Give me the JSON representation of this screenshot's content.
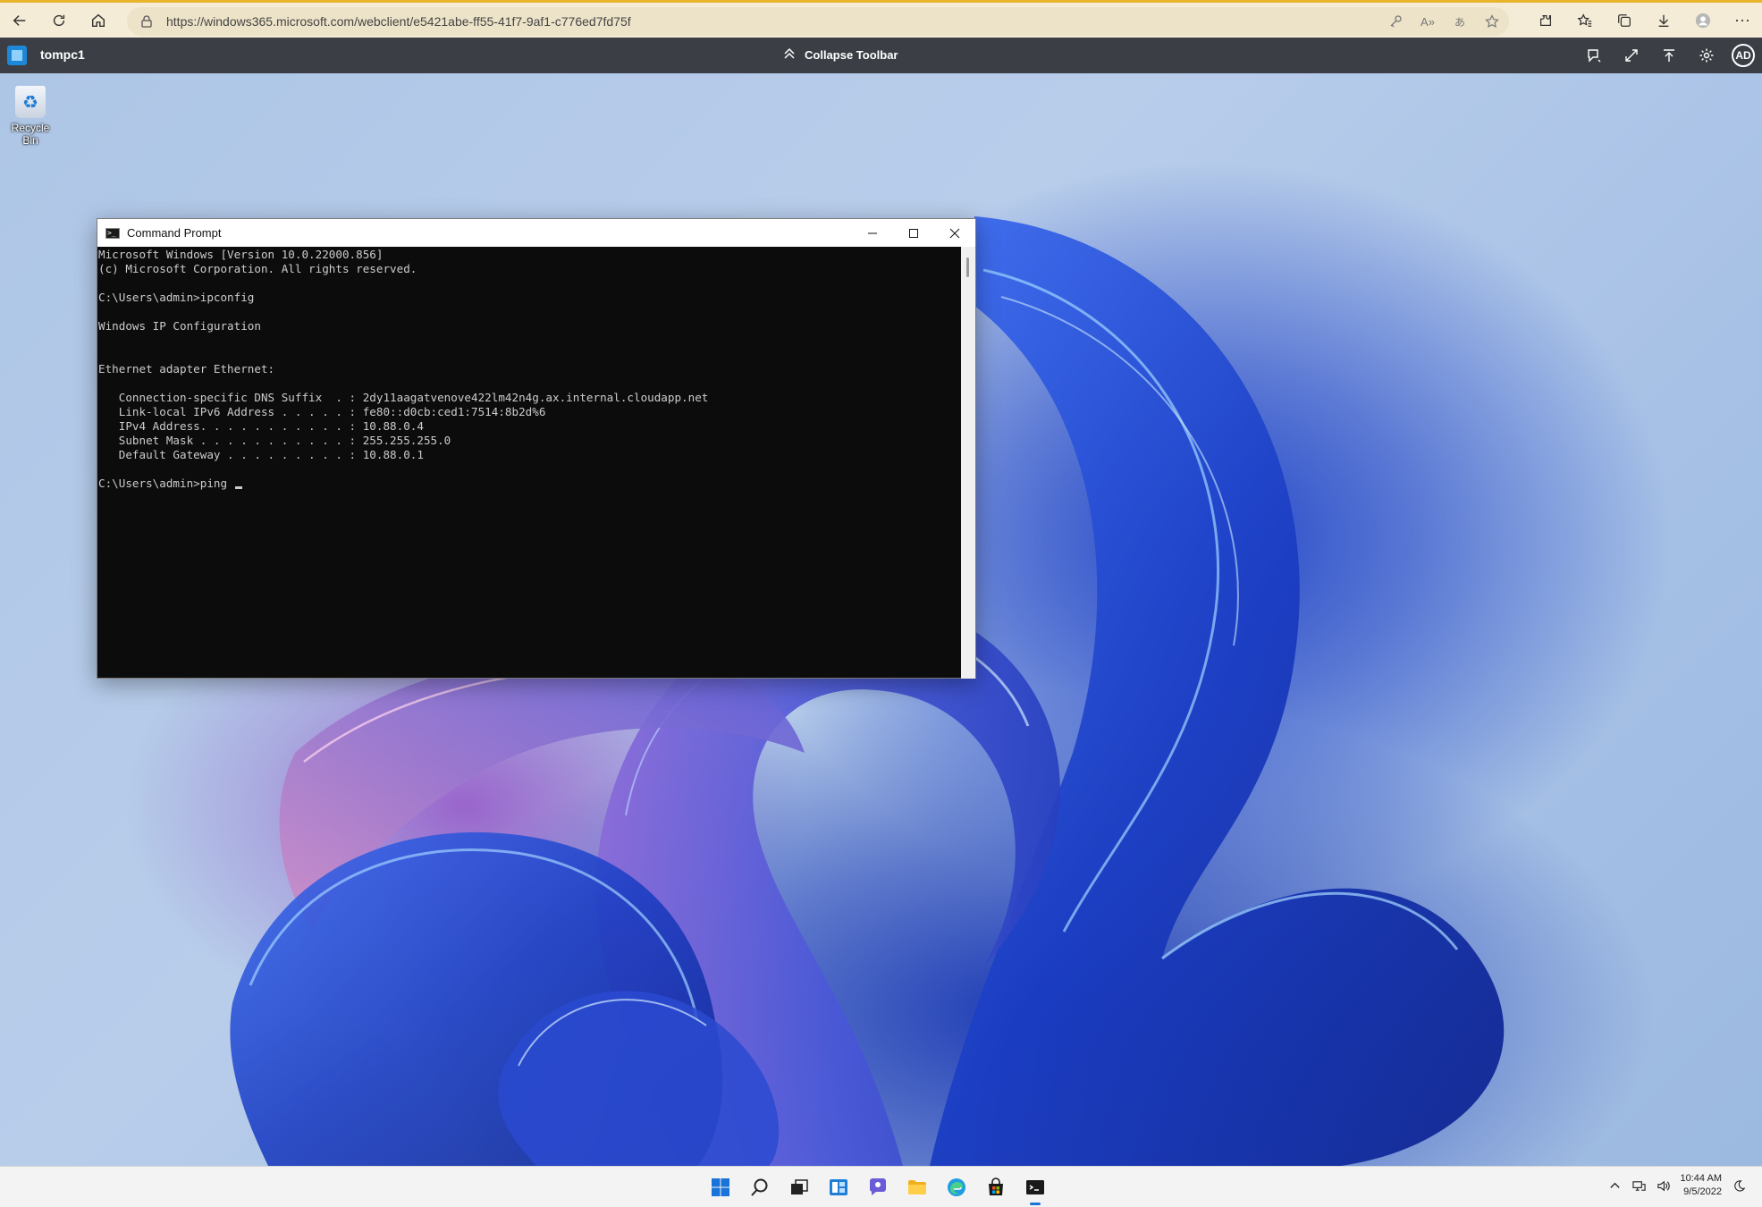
{
  "browser": {
    "url": "https://windows365.microsoft.com/webclient/e5421abe-ff55-41f7-9af1-c776ed7fd75f",
    "icons": [
      "back-icon",
      "refresh-icon",
      "home-icon",
      "lock-icon",
      "key-icon",
      "read-aloud-icon",
      "translate-icon",
      "favorite-add-icon",
      "extensions-icon",
      "favorites-icon",
      "collections-icon",
      "downloads-icon",
      "profile-icon",
      "more-icon"
    ]
  },
  "toolbar": {
    "pc_name": "tompc1",
    "collapse_label": "Collapse Toolbar",
    "avatar_initials": "AD",
    "icons": [
      "remote-logo-icon",
      "feedback-icon",
      "fullscreen-icon",
      "upload-icon",
      "settings-icon"
    ]
  },
  "desktop": {
    "recycle_bin_label": "Recycle Bin"
  },
  "cmd": {
    "title": "Command Prompt",
    "lines": [
      "Microsoft Windows [Version 10.0.22000.856]",
      "(c) Microsoft Corporation. All rights reserved.",
      "",
      "C:\\Users\\admin>ipconfig",
      "",
      "Windows IP Configuration",
      "",
      "",
      "Ethernet adapter Ethernet:",
      "",
      "   Connection-specific DNS Suffix  . : 2dy11aagatvenove422lm42n4g.ax.internal.cloudapp.net",
      "   Link-local IPv6 Address . . . . . : fe80::d0cb:ced1:7514:8b2d%6",
      "   IPv4 Address. . . . . . . . . . . : 10.88.0.4",
      "   Subnet Mask . . . . . . . . . . . : 255.255.255.0",
      "   Default Gateway . . . . . . . . . : 10.88.0.1",
      "",
      "C:\\Users\\admin>ping"
    ]
  },
  "taskbar": {
    "apps": [
      "start-icon",
      "search-icon",
      "task-view-icon",
      "widgets-icon",
      "chat-icon",
      "file-explorer-icon",
      "edge-icon",
      "store-icon",
      "terminal-icon"
    ],
    "time": "10:44 AM",
    "date": "9/5/2022"
  },
  "colors": {
    "browser_bar": "#f4ecd6",
    "toolbar_bg": "#3b3f45",
    "cmd_bg": "#0c0c0c",
    "cmd_text": "#cccccc",
    "taskbar_bg": "#f3f3f3",
    "accent": "#1a73d9"
  }
}
